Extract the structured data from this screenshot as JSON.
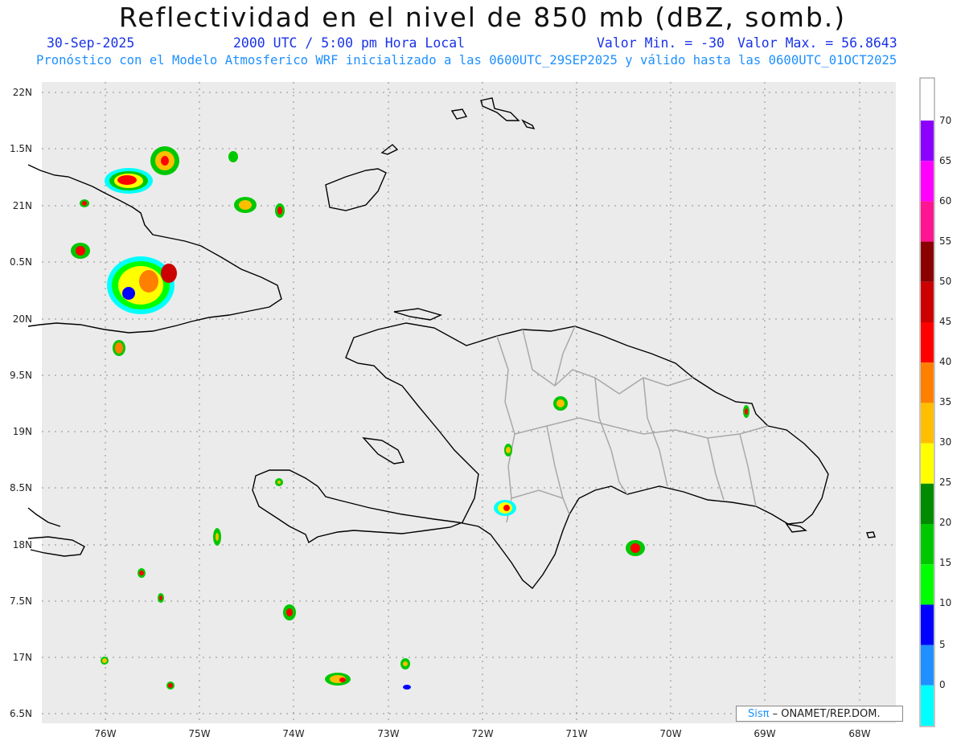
{
  "header": {
    "title": "Reflectividad en el nivel de 850 mb (dBZ, somb.)",
    "date": "30-Sep-2025",
    "time": "2000 UTC / 5:00 pm Hora Local",
    "min_label": "Valor Min. = -30",
    "max_label": "Valor Max. = 56.8643",
    "forecast": "Pronóstico con el Modelo Atmosferico WRF inicializado a las 0600UTC_29SEP2025 y válido hasta las  0600UTC_01OCT2025"
  },
  "axes": {
    "lat_labels": [
      "22N",
      "1.5N",
      "21N",
      "0.5N",
      "20N",
      "9.5N",
      "19N",
      "8.5N",
      "18N",
      "7.5N",
      "17N",
      "6.5N"
    ],
    "lon_labels": [
      "76W",
      "75W",
      "74W",
      "73W",
      "72W",
      "71W",
      "70W",
      "69W",
      "68W"
    ]
  },
  "colorbar": {
    "labels": [
      "70",
      "65",
      "60",
      "55",
      "50",
      "45",
      "40",
      "35",
      "30",
      "25",
      "20",
      "15",
      "10",
      "5",
      "0"
    ],
    "colors": [
      "#8b00ff",
      "#ff00ff",
      "#ff1493",
      "#8b0000",
      "#cc0000",
      "#ff0000",
      "#ff7f00",
      "#ffbf00",
      "#ffff00",
      "#008b00",
      "#00c800",
      "#00ff00",
      "#0000ff",
      "#1e90ff",
      "#00ffff"
    ],
    "below_color": "#ebebeb"
  },
  "credit": {
    "logo": "Sisπ",
    "text": "– ONAMET/REP.DOM."
  }
}
